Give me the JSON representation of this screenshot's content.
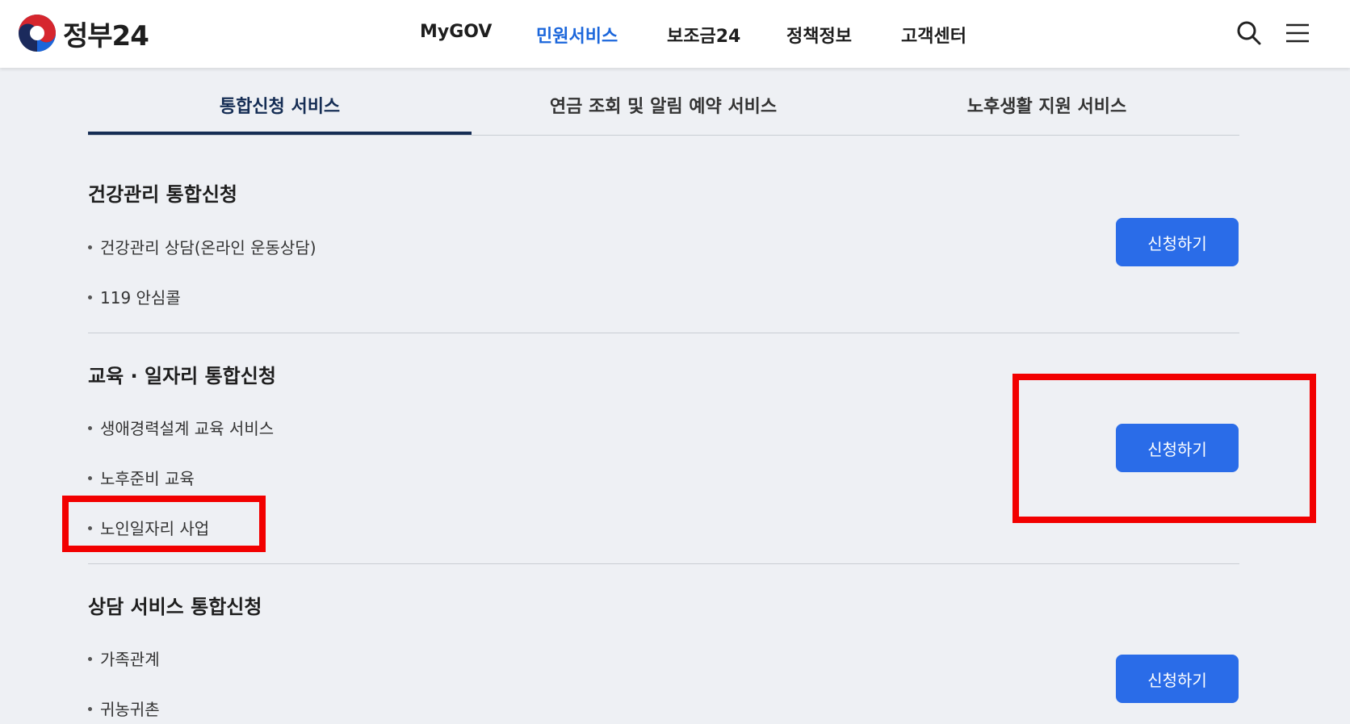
{
  "header": {
    "logo_text": "정부24",
    "nav": [
      "MyGOV",
      "민원서비스",
      "보조금24",
      "정책정보",
      "고객센터"
    ],
    "active_nav": "민원서비스",
    "icons": [
      "search-icon",
      "menu-icon"
    ]
  },
  "tabs": [
    {
      "label": "통합신청 서비스",
      "active": true
    },
    {
      "label": "연금 조회 및 알림 예약 서비스",
      "active": false
    },
    {
      "label": "노후생활 지원 서비스",
      "active": false
    }
  ],
  "sections": [
    {
      "title": "건강관리 통합신청",
      "items": [
        "건강관리 상담(온라인 운동상담)",
        "119 안심콜"
      ],
      "button": "신청하기"
    },
    {
      "title": "교육 · 일자리 통합신청",
      "items": [
        "생애경력설계 교육 서비스",
        "노후준비 교육",
        "노인일자리 사업"
      ],
      "button": "신청하기"
    },
    {
      "title": "상담 서비스 통합신청",
      "items": [
        "가족관계",
        "귀농귀촌"
      ],
      "button": "신청하기"
    }
  ],
  "colors": {
    "accent": "#1b66db",
    "button": "#2a6ce8",
    "tab_active": "#152d54",
    "highlight": "#f20000",
    "background": "#eef0f4"
  }
}
